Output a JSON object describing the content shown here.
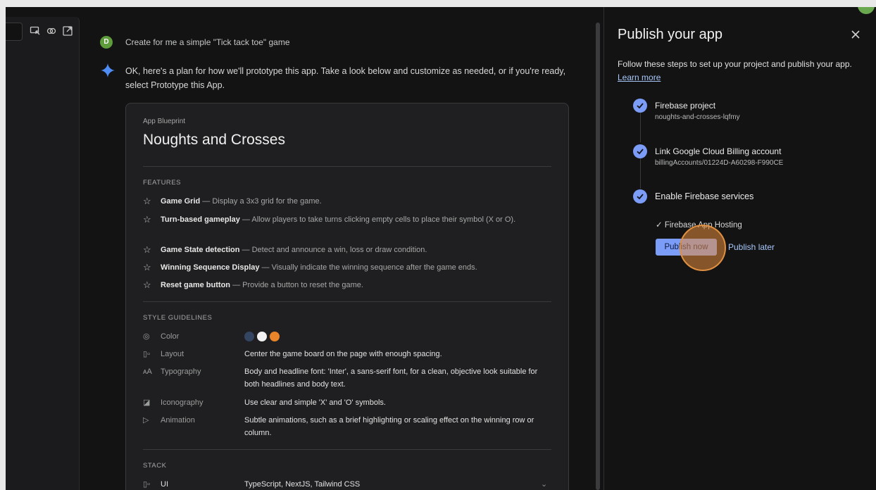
{
  "chat": {
    "user_initial": "D",
    "user_message": "Create for me a simple \"Tick tack toe\" game",
    "bot_message": "OK, here's a plan for how we'll prototype this app. Take a look below and customize as needed, or if you're ready, select Prototype this App."
  },
  "blueprint": {
    "kicker": "App Blueprint",
    "title": "Noughts and Crosses",
    "features_label": "FEATURES",
    "features": [
      {
        "name": "Game Grid",
        "desc": " — Display a 3x3 grid for the game."
      },
      {
        "name": "Turn-based gameplay",
        "desc": " — Allow players to take turns clicking empty cells to place their symbol (X or O)."
      },
      {
        "name": "Game State detection",
        "desc": " — Detect and announce a win, loss or draw condition."
      },
      {
        "name": "Winning Sequence Display",
        "desc": " — Visually indicate the winning sequence after the game ends."
      },
      {
        "name": "Reset game button",
        "desc": " — Provide a button to reset the game."
      }
    ],
    "style_label": "STYLE GUIDELINES",
    "style": {
      "color_key": "Color",
      "colors": [
        "#344561",
        "#f2f2f2",
        "#e8852b"
      ],
      "layout_key": "Layout",
      "layout_val": "Center the game board on the page with enough spacing.",
      "typography_key": "Typography",
      "typography_val": "Body and headline font: 'Inter', a sans-serif font, for a clean, objective look suitable for both headlines and body text.",
      "iconography_key": "Iconography",
      "iconography_val": "Use clear and simple 'X' and 'O' symbols.",
      "animation_key": "Animation",
      "animation_val": "Subtle animations, such as a brief highlighting or scaling effect on the winning row or column."
    },
    "stack_label": "STACK",
    "stack": {
      "key": "UI",
      "val": "TypeScript, NextJS, Tailwind CSS"
    }
  },
  "panel": {
    "title": "Publish your app",
    "desc": "Follow these steps to set up your project and publish your app.",
    "learn_more": "Learn more",
    "steps": [
      {
        "title": "Firebase project",
        "sub": "noughts-and-crosses-lqfmy"
      },
      {
        "title": "Link Google Cloud Billing account",
        "sub": "billingAccounts/01224D-A60298-F990CE"
      },
      {
        "title": "Enable Firebase services",
        "sub": ""
      }
    ],
    "service": "✓  Firebase App Hosting",
    "publish_now": "Publish now",
    "publish_later": "Publish later"
  },
  "icons": {
    "star": "☆",
    "close": "close-icon",
    "check": "check-icon"
  }
}
